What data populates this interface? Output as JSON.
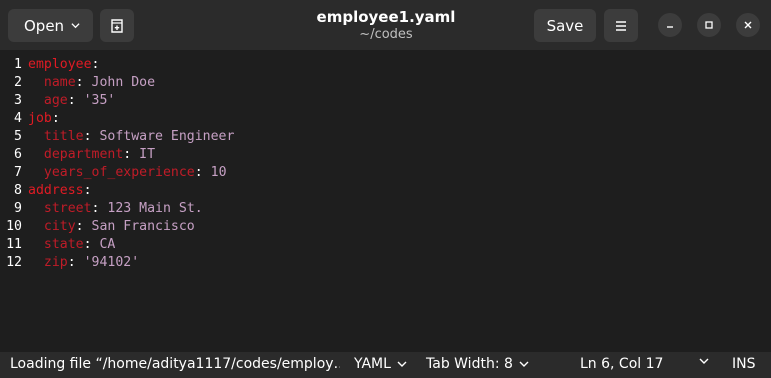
{
  "header": {
    "open_label": "Open",
    "save_label": "Save",
    "title": "employee1.yaml",
    "subtitle": "~/codes"
  },
  "editor": {
    "lines": [
      {
        "n": "1",
        "segs": [
          {
            "t": "employee",
            "c": "k0"
          },
          {
            "t": ":",
            "c": "p"
          }
        ]
      },
      {
        "n": "2",
        "segs": [
          {
            "t": "  name",
            "c": "k1"
          },
          {
            "t": ": ",
            "c": "p"
          },
          {
            "t": "John Doe",
            "c": "v"
          }
        ]
      },
      {
        "n": "3",
        "segs": [
          {
            "t": "  age",
            "c": "k1"
          },
          {
            "t": ": ",
            "c": "p"
          },
          {
            "t": "'35'",
            "c": "v"
          }
        ]
      },
      {
        "n": "4",
        "segs": [
          {
            "t": "job",
            "c": "k0"
          },
          {
            "t": ":",
            "c": "p"
          }
        ]
      },
      {
        "n": "5",
        "segs": [
          {
            "t": "  title",
            "c": "k1"
          },
          {
            "t": ": ",
            "c": "p"
          },
          {
            "t": "Software Engineer",
            "c": "v"
          }
        ]
      },
      {
        "n": "6",
        "segs": [
          {
            "t": "  department",
            "c": "k1"
          },
          {
            "t": ": ",
            "c": "p"
          },
          {
            "t": "IT",
            "c": "v"
          }
        ]
      },
      {
        "n": "7",
        "segs": [
          {
            "t": "  years_of_experience",
            "c": "k1"
          },
          {
            "t": ": ",
            "c": "p"
          },
          {
            "t": "10",
            "c": "v"
          }
        ]
      },
      {
        "n": "8",
        "segs": [
          {
            "t": "address",
            "c": "k0"
          },
          {
            "t": ":",
            "c": "p"
          }
        ]
      },
      {
        "n": "9",
        "segs": [
          {
            "t": "  street",
            "c": "k1"
          },
          {
            "t": ": ",
            "c": "p"
          },
          {
            "t": "123 Main St.",
            "c": "v"
          }
        ]
      },
      {
        "n": "10",
        "segs": [
          {
            "t": "  city",
            "c": "k1"
          },
          {
            "t": ": ",
            "c": "p"
          },
          {
            "t": "San Francisco",
            "c": "v"
          }
        ]
      },
      {
        "n": "11",
        "segs": [
          {
            "t": "  state",
            "c": "k1"
          },
          {
            "t": ": ",
            "c": "p"
          },
          {
            "t": "CA",
            "c": "v"
          }
        ]
      },
      {
        "n": "12",
        "segs": [
          {
            "t": "  zip",
            "c": "k1"
          },
          {
            "t": ": ",
            "c": "p"
          },
          {
            "t": "'94102'",
            "c": "v"
          }
        ]
      }
    ]
  },
  "statusbar": {
    "message": "Loading file “/home/aditya1117/codes/employ…",
    "language": "YAML",
    "tab_width": "Tab Width: 8",
    "cursor": "Ln 6, Col 17",
    "mode": "INS"
  },
  "icons": {
    "open_chevron": "chevron-down-icon",
    "new_tab": "new-tab-icon",
    "menu": "hamburger-menu-icon",
    "minimize": "minimize-icon",
    "maximize": "maximize-icon",
    "close": "close-icon"
  },
  "colors": {
    "background": "#1e1e1e",
    "header": "#2b2b2b",
    "button": "#3c3c3c",
    "yaml_key": "#c01c28",
    "yaml_value": "#c6a0c4"
  }
}
